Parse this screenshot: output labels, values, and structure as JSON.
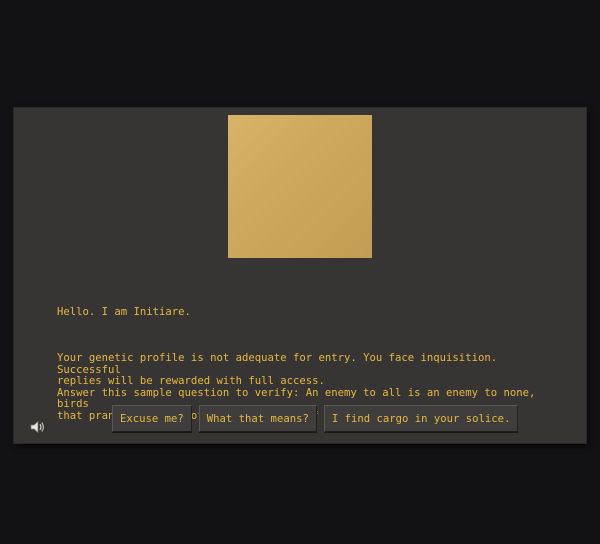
{
  "dialogue": {
    "greeting": "Hello. I am Initiare.",
    "body": "Your genetic profile is not adequate for entry. You face inquisition. Successful\nreplies will be rewarded with full access.\nAnswer this sample question to verify: An enemy to all is an enemy to none, birds\nthat prance are full of heart; Instead of furious?"
  },
  "choices": [
    {
      "label": "Excuse me?"
    },
    {
      "label": "What that means?"
    },
    {
      "label": "I find cargo in your solice."
    }
  ],
  "colors": {
    "text": "#e7b741",
    "panel": "#363534",
    "background": "#121113",
    "portrait": "#cfa95e"
  },
  "icons": {
    "sound": "speaker-icon"
  }
}
